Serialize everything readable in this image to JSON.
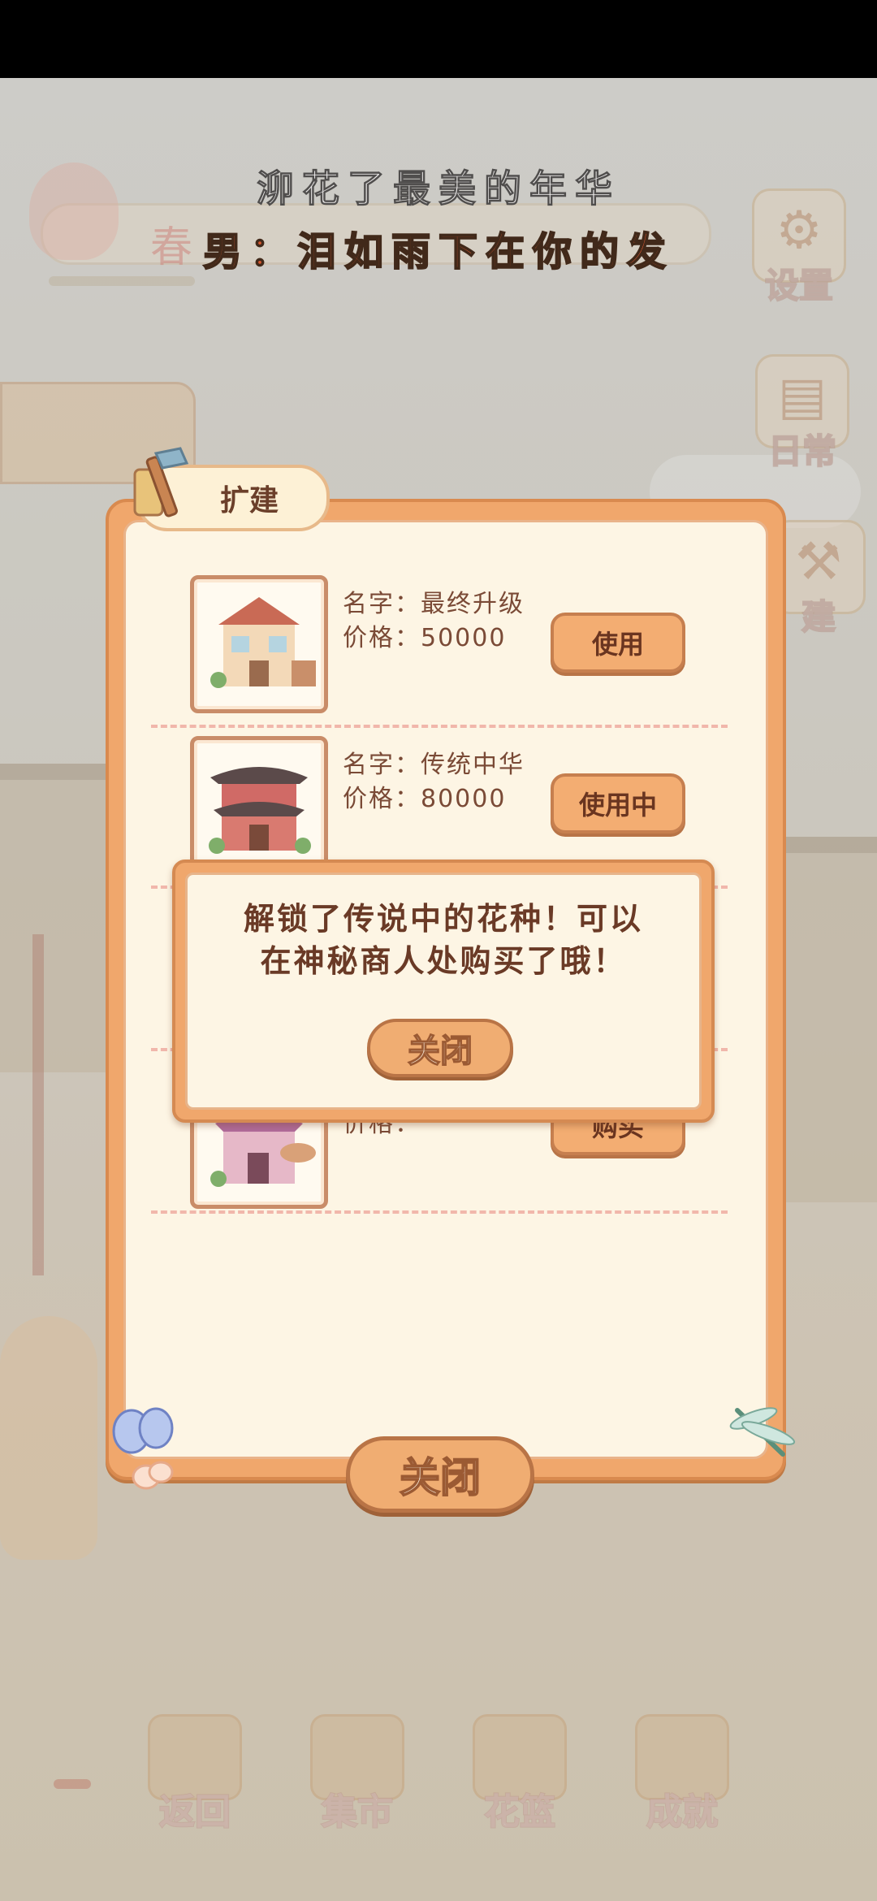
{
  "lyrics": {
    "line1": "泖花了最美的年华",
    "line2": "男：泪如雨下在你的发"
  },
  "top_bar": {
    "season_label": "春",
    "settings_label": "设置",
    "daily_label": "日常",
    "build_label": "建"
  },
  "expand_panel": {
    "title": "扩建",
    "items": [
      {
        "name": "名字：最终升级",
        "price": "价格：50000",
        "button": "使用"
      },
      {
        "name": "名字：传统中华",
        "price": "价格：80000",
        "button": "使用中"
      },
      {
        "name": "",
        "price": "价格：",
        "button": "购买"
      }
    ],
    "close_label": "关闭"
  },
  "notice_dialog": {
    "message_line1": "解锁了传说中的花种！可以",
    "message_line2": "在神秘商人处购买了哦！",
    "close_label": "关闭"
  },
  "bottom_nav": {
    "items": [
      {
        "label": "返回"
      },
      {
        "label": "集市"
      },
      {
        "label": "花篮"
      },
      {
        "label": "成就"
      }
    ]
  }
}
